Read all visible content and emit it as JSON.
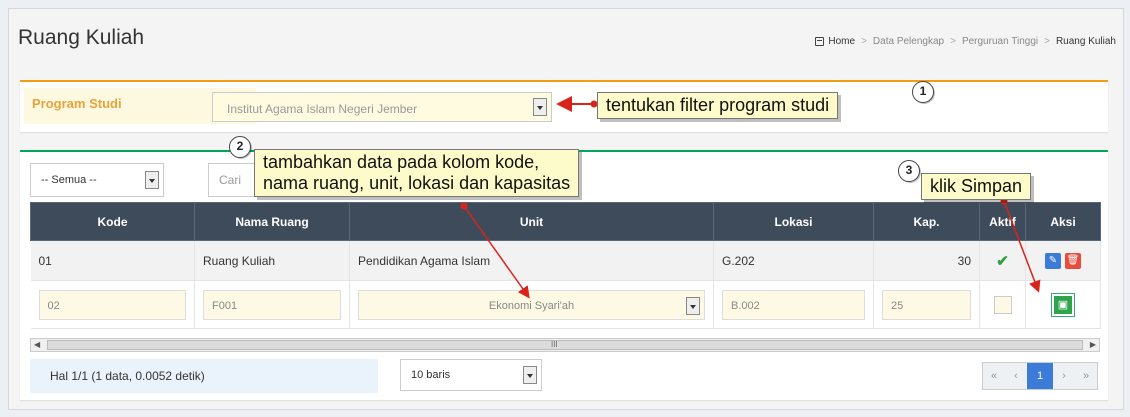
{
  "page": {
    "title": "Ruang Kuliah"
  },
  "breadcrumb": {
    "home": "Home",
    "items": [
      "Data Pelengkap",
      "Perguruan Tinggi",
      "Ruang Kuliah"
    ]
  },
  "filter": {
    "label": "Program Studi",
    "value": "Institut Agama Islam Negeri Jember"
  },
  "toolbar": {
    "status_filter": "-- Semua --",
    "search_placeholder": "Cari"
  },
  "table": {
    "headers": [
      "Kode",
      "Nama Ruang",
      "Unit",
      "Lokasi",
      "Kap.",
      "Aktif",
      "Aksi"
    ],
    "rows": [
      {
        "kode": "01",
        "nama": "Ruang Kuliah",
        "unit": "Pendidikan Agama Islam",
        "lokasi": "G.202",
        "kap": "30",
        "aktif": "✔"
      }
    ],
    "edit_row": {
      "kode": "02",
      "nama": "F001",
      "unit": "Ekonomi Syari'ah",
      "lokasi": "B.002",
      "kap": "25"
    }
  },
  "footer": {
    "info": "Hal 1/1 (1 data, 0.0052 detik)",
    "rows_per_page": "10 baris",
    "pager": {
      "first": "«",
      "prev": "‹",
      "current": "1",
      "next": "›",
      "last": "»"
    }
  },
  "annotations": {
    "c1": {
      "num": "1",
      "text": "tentukan filter program studi"
    },
    "c2": {
      "num": "2",
      "line1": "tambahkan data pada kolom kode,",
      "line2": "nama ruang, unit, lokasi dan kapasitas"
    },
    "c3": {
      "num": "3",
      "text": "klik Simpan"
    }
  },
  "colors": {
    "header_bg": "#3e4b5b",
    "accent_warning": "#f39c12",
    "accent_success": "#00a65a",
    "primary": "#3c7bd8",
    "danger": "#e74c3c",
    "arrow": "#d9241c"
  }
}
